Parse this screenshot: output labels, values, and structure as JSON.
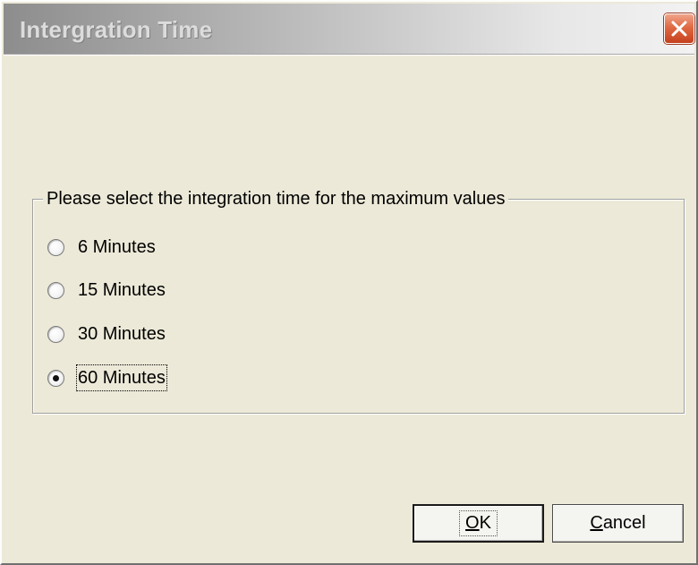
{
  "window": {
    "title": "Intergration Time"
  },
  "group": {
    "legend": "Please select the integration time for the maximum values",
    "options": [
      {
        "label": "6 Minutes",
        "selected": false
      },
      {
        "label": "15 Minutes",
        "selected": false
      },
      {
        "label": "30 Minutes",
        "selected": false
      },
      {
        "label": "60 Minutes",
        "selected": true
      }
    ]
  },
  "buttons": {
    "ok": {
      "mnemonic": "O",
      "rest": "K"
    },
    "cancel": {
      "mnemonic": "C",
      "rest": "ancel"
    }
  },
  "icons": {
    "close": "close-icon"
  },
  "colors": {
    "face": "#ece9d8",
    "close_button": "#d85a36"
  }
}
